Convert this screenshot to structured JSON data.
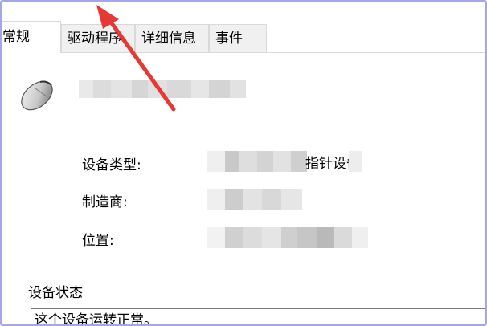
{
  "tabs": [
    {
      "label": "常规"
    },
    {
      "label": "驱动程序"
    },
    {
      "label": "详细信息"
    },
    {
      "label": "事件"
    }
  ],
  "device": {
    "icon": "mouse-icon",
    "name_redacted": true
  },
  "properties": {
    "type_label": "设备类型:",
    "type_value_visible": "指针设备",
    "manufacturer_label": "制造商:",
    "location_label": "位置:"
  },
  "status": {
    "group_title": "设备状态",
    "text": "这个设备运转正常。"
  },
  "colors": {
    "frame_border": "#a3a7e6",
    "annotation_arrow": "#e53935",
    "tab_inactive_bg": "#f0f0f0"
  }
}
